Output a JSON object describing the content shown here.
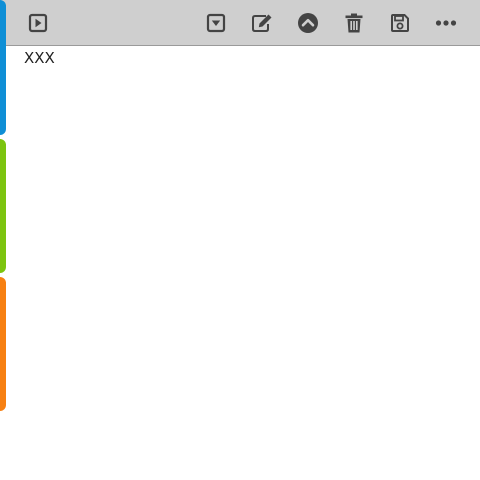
{
  "toolbar": {
    "buttons": [
      {
        "icon": "play-square-icon"
      },
      {
        "icon": "dropdown-square-icon"
      },
      {
        "icon": "edit-icon"
      },
      {
        "icon": "chevron-up-circle-icon"
      },
      {
        "icon": "trash-icon"
      },
      {
        "icon": "save-icon"
      },
      {
        "icon": "more-horizontal-icon"
      }
    ],
    "icon_color": "#444444",
    "background": "#cfcfcf"
  },
  "tabs": [
    {
      "color": "#0f8fd6"
    },
    {
      "color": "#7cc40f"
    },
    {
      "color": "#f78012"
    }
  ],
  "content": {
    "text": "XXX"
  }
}
